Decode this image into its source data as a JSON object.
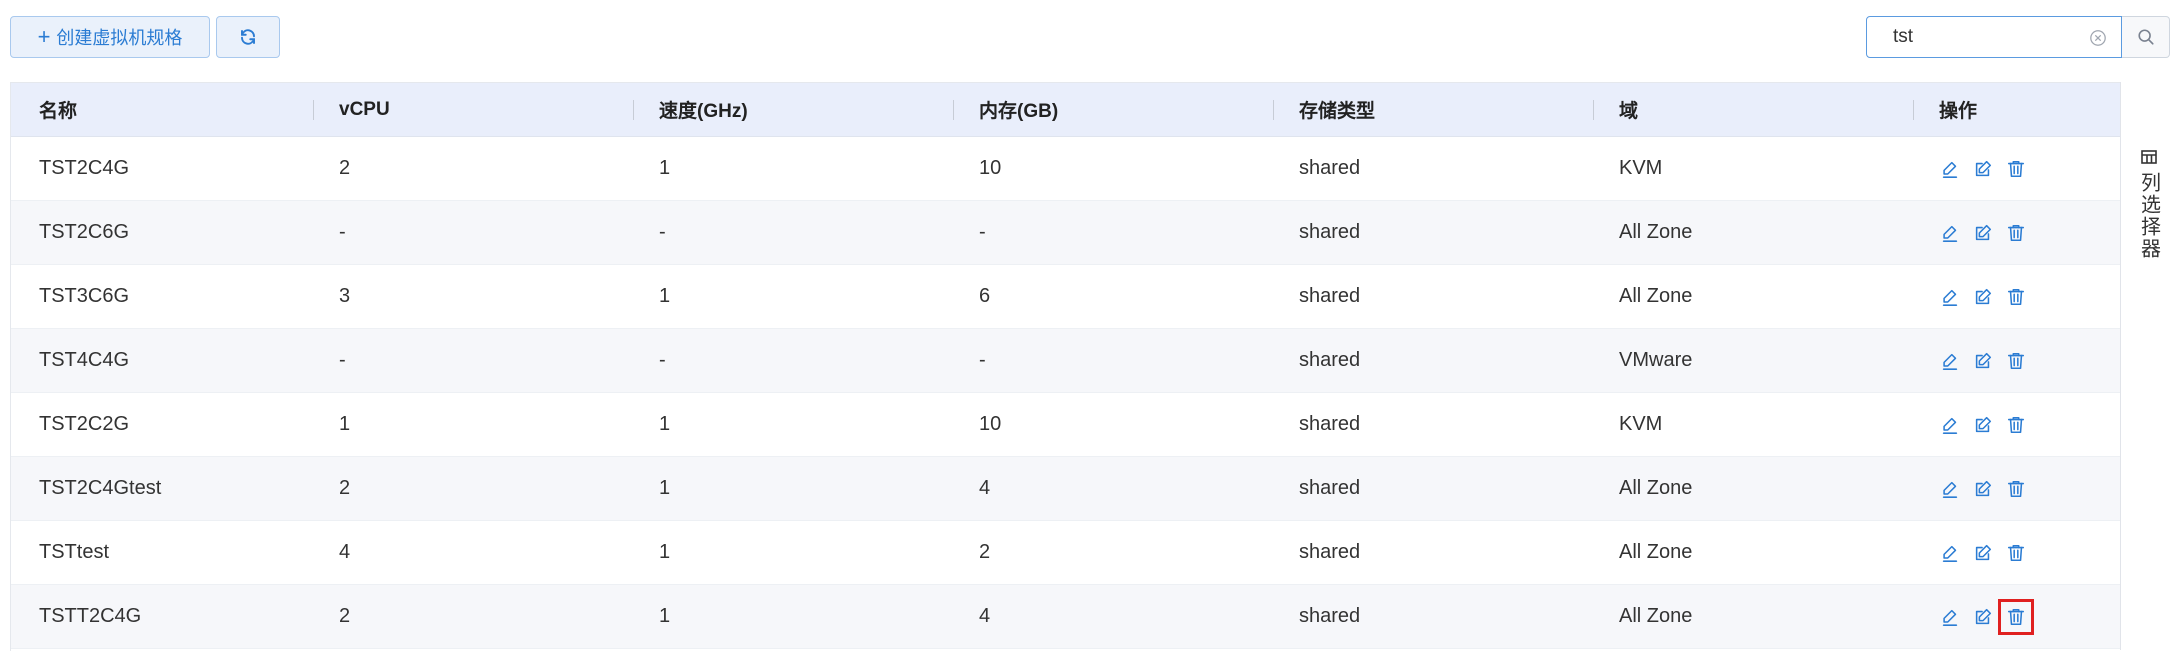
{
  "toolbar": {
    "create_label": "创建虚拟机规格",
    "create_icon": "plus-icon",
    "refresh_icon": "refresh-icon"
  },
  "search": {
    "value": "tst",
    "clear_icon": "clear-circle-icon",
    "search_icon": "search-icon"
  },
  "table": {
    "columns": [
      "名称",
      "vCPU",
      "速度(GHz)",
      "内存(GB)",
      "存储类型",
      "域",
      "操作"
    ],
    "rows": [
      {
        "name": "TST2C4G",
        "vcpu": "2",
        "speed": "1",
        "memory": "10",
        "storage": "shared",
        "zone": "KVM"
      },
      {
        "name": "TST2C6G",
        "vcpu": "-",
        "speed": "-",
        "memory": "-",
        "storage": "shared",
        "zone": "All Zone"
      },
      {
        "name": "TST3C6G",
        "vcpu": "3",
        "speed": "1",
        "memory": "6",
        "storage": "shared",
        "zone": "All Zone"
      },
      {
        "name": "TST4C4G",
        "vcpu": "-",
        "speed": "-",
        "memory": "-",
        "storage": "shared",
        "zone": "VMware"
      },
      {
        "name": "TST2C2G",
        "vcpu": "1",
        "speed": "1",
        "memory": "10",
        "storage": "shared",
        "zone": "KVM"
      },
      {
        "name": "TST2C4Gtest",
        "vcpu": "2",
        "speed": "1",
        "memory": "4",
        "storage": "shared",
        "zone": "All Zone"
      },
      {
        "name": "TSTtest",
        "vcpu": "4",
        "speed": "1",
        "memory": "2",
        "storage": "shared",
        "zone": "All Zone"
      },
      {
        "name": "TSTT2C4G",
        "vcpu": "2",
        "speed": "1",
        "memory": "4",
        "storage": "shared",
        "zone": "All Zone"
      }
    ],
    "row_actions": [
      "edit-pen-icon",
      "edit-box-icon",
      "delete-trash-icon"
    ],
    "highlighted_action": {
      "row": 7,
      "action": "delete-trash-icon"
    }
  },
  "column_picker": {
    "label": "列选择器",
    "icon": "columns-grid-icon"
  },
  "colors": {
    "accent": "#2b7cd3",
    "header_bg": "#e9eefb",
    "highlight": "#e02020"
  }
}
